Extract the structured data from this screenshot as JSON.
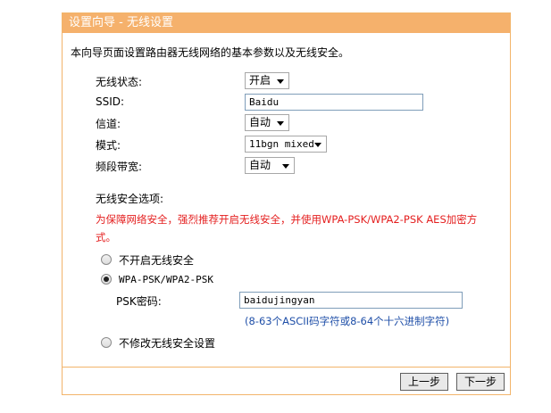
{
  "title": "设置向导 - 无线设置",
  "intro": "本向导页面设置路由器无线网络的基本参数以及无线安全。",
  "fields": {
    "status": {
      "label": "无线状态:",
      "value": "开启"
    },
    "ssid": {
      "label": "SSID:",
      "value": "Baidu"
    },
    "channel": {
      "label": "信道:",
      "value": "自动"
    },
    "mode": {
      "label": "模式:",
      "value": "11bgn mixed"
    },
    "bandwidth": {
      "label": "频段带宽:",
      "value": "自动"
    }
  },
  "security": {
    "heading": "无线安全选项:",
    "warning_line1": "为保障网络安全，强烈推荐开启无线安全，并使用WPA-PSK/WPA2-PSK AES加密方",
    "warning_line2": "式。",
    "option_off": "不开启无线安全",
    "option_wpa": "WPA-PSK/WPA2-PSK",
    "psk_label": "PSK密码:",
    "psk_value": "baidujingyan",
    "psk_hint": "(8-63个ASCII码字符或8-64个十六进制字符)",
    "option_keep": "不修改无线安全设置"
  },
  "buttons": {
    "prev": "上一步",
    "next": "下一步"
  }
}
